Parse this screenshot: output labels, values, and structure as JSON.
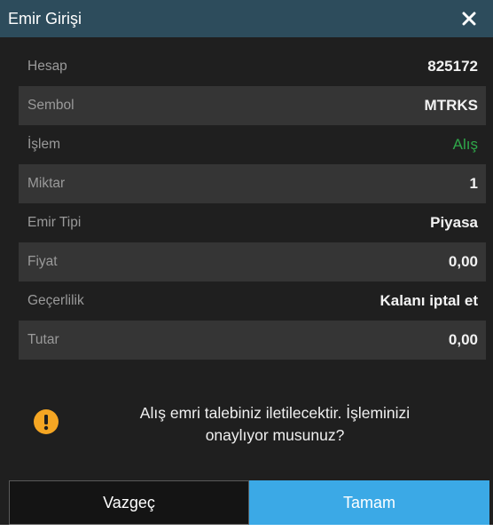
{
  "dialog": {
    "title": "Emir Girişi",
    "close_icon": "close-icon"
  },
  "fields": [
    {
      "label": "Hesap",
      "value": "825172"
    },
    {
      "label": "Sembol",
      "value": "MTRKS"
    },
    {
      "label": "İşlem",
      "value": "Alış"
    },
    {
      "label": "Miktar",
      "value": "1"
    },
    {
      "label": "Emir Tipi",
      "value": "Piyasa"
    },
    {
      "label": "Fiyat",
      "value": "0,00"
    },
    {
      "label": "Geçerlilik",
      "value": "Kalanı iptal et"
    },
    {
      "label": "Tutar",
      "value": "0,00"
    }
  ],
  "notice": {
    "icon": "warning-icon",
    "line1": "Alış emri talebiniz iletilecektir. İşleminizi",
    "line2": "onaylıyor musunuz?"
  },
  "buttons": {
    "cancel_label": "Vazgeç",
    "ok_label": "Tamam"
  },
  "colors": {
    "titlebar": "#2d4c5c",
    "background": "#1f1f1f",
    "buy_green": "#2fa84a",
    "ok_button": "#3ba9e6",
    "warning": "#f5a623"
  }
}
